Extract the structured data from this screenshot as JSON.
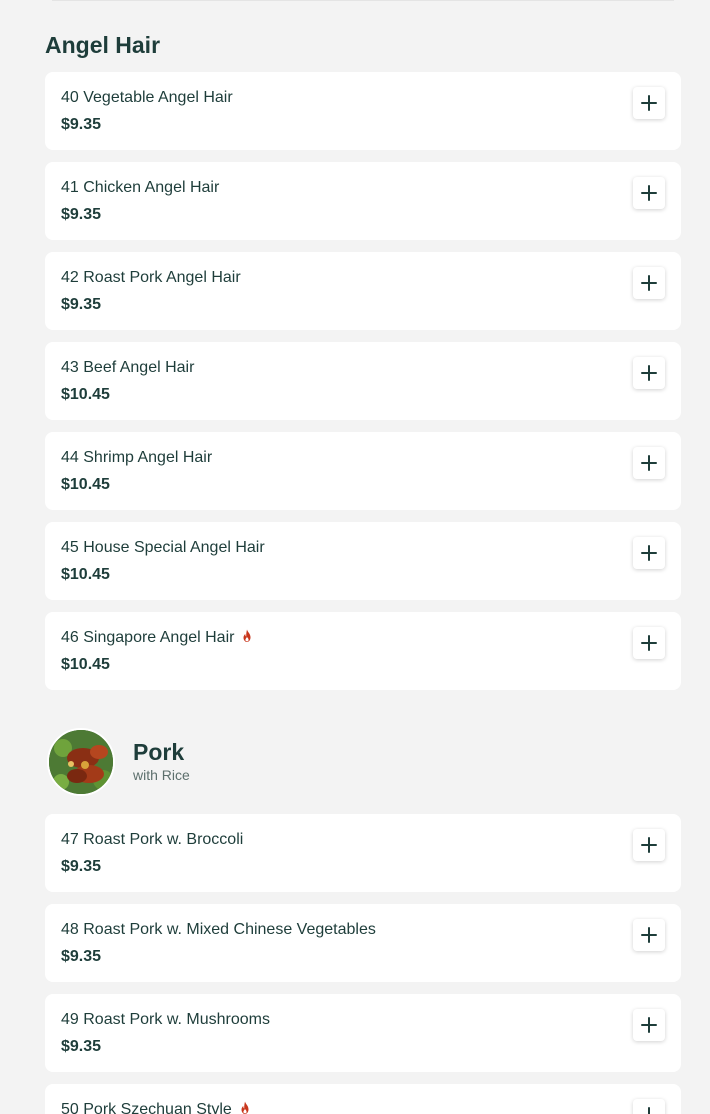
{
  "sections": [
    {
      "title": "Angel Hair",
      "subtitle": "",
      "items": [
        {
          "name": "40 Vegetable Angel Hair",
          "price": "$9.35",
          "spicy": false
        },
        {
          "name": "41 Chicken Angel Hair",
          "price": "$9.35",
          "spicy": false
        },
        {
          "name": "42 Roast Pork Angel Hair",
          "price": "$9.35",
          "spicy": false
        },
        {
          "name": "43 Beef Angel Hair",
          "price": "$10.45",
          "spicy": false
        },
        {
          "name": "44 Shrimp Angel Hair",
          "price": "$10.45",
          "spicy": false
        },
        {
          "name": "45 House Special Angel Hair",
          "price": "$10.45",
          "spicy": false
        },
        {
          "name": "46 Singapore Angel Hair",
          "price": "$10.45",
          "spicy": true
        }
      ]
    },
    {
      "title": "Pork",
      "subtitle": "with Rice",
      "items": [
        {
          "name": "47 Roast Pork w. Broccoli",
          "price": "$9.35",
          "spicy": false
        },
        {
          "name": "48 Roast Pork w. Mixed Chinese Vegetables",
          "price": "$9.35",
          "spicy": false
        },
        {
          "name": "49 Roast Pork w. Mushrooms",
          "price": "$9.35",
          "spicy": false
        },
        {
          "name": "50 Pork Szechuan Style",
          "price": "",
          "spicy": true
        }
      ]
    }
  ],
  "icons": {
    "add": "plus-icon",
    "spicy": "flame-icon",
    "category_image": "pork-dish-image"
  },
  "colors": {
    "background": "#f3f3f3",
    "card": "#ffffff",
    "text": "#1e3d3a",
    "spicy": "#c8361c"
  }
}
